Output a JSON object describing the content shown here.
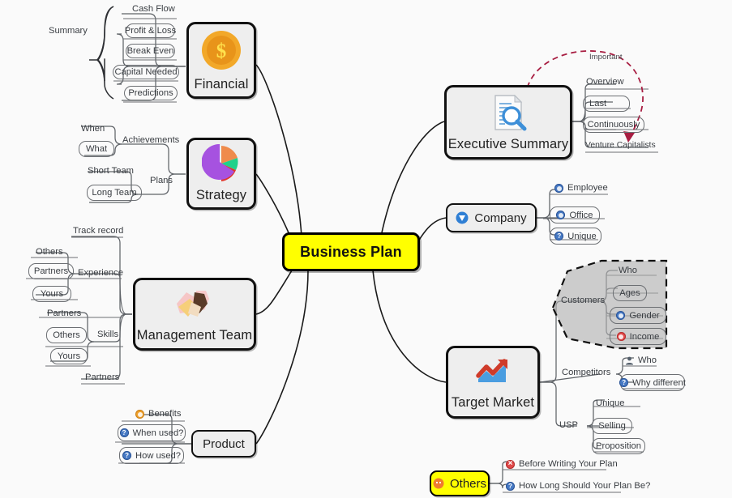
{
  "map": {
    "central": {
      "label": "Business Plan",
      "color": "#ffff00"
    },
    "annotation": {
      "label": "Important",
      "color": "#a81e42"
    },
    "branches": [
      {
        "id": "financial",
        "label": "Financial",
        "icon": "dollar-coin-icon",
        "children": [
          {
            "label": "Summary",
            "children": [
              {
                "label": "Cash Flow"
              },
              {
                "label": "Profit & Loss"
              },
              {
                "label": "Break Even"
              }
            ]
          },
          {
            "label": "Capital Needed"
          },
          {
            "label": "Predictions"
          }
        ]
      },
      {
        "id": "strategy",
        "label": "Strategy",
        "icon": "pie-chart-icon",
        "children": [
          {
            "label": "Achievements",
            "children": [
              {
                "label": "When"
              },
              {
                "label": "What"
              }
            ]
          },
          {
            "label": "Plans",
            "children": [
              {
                "label": "Short Team"
              },
              {
                "label": "Long Team"
              }
            ]
          }
        ]
      },
      {
        "id": "management-team",
        "label": "Management Team",
        "icon": "handshake-icon",
        "children": [
          {
            "label": "Track record"
          },
          {
            "label": "Experience",
            "children": [
              {
                "label": "Others"
              },
              {
                "label": "Partners"
              },
              {
                "label": "Yours"
              }
            ]
          },
          {
            "label": "Skills",
            "children": [
              {
                "label": "Partners"
              },
              {
                "label": "Others"
              },
              {
                "label": "Yours"
              }
            ]
          },
          {
            "label": "Partners"
          }
        ]
      },
      {
        "id": "product",
        "label": "Product",
        "icon": "none",
        "children": [
          {
            "label": "Benefits",
            "icon": "orange-dot-icon"
          },
          {
            "label": "When used?",
            "icon": "blue-question-icon"
          },
          {
            "label": "How used?",
            "icon": "blue-question-icon"
          }
        ]
      },
      {
        "id": "executive-summary",
        "label": "Executive Summary",
        "icon": "document-search-icon",
        "children": [
          {
            "label": "Overview"
          },
          {
            "label": "Last"
          },
          {
            "label": "Continuously"
          },
          {
            "label": "Venture Capitalists"
          }
        ]
      },
      {
        "id": "company",
        "label": "Company",
        "icon": "blue-shield-icon",
        "children": [
          {
            "label": "Employee",
            "icon": "blue-clock-icon"
          },
          {
            "label": "Office",
            "icon": "blue-dot-icon"
          },
          {
            "label": "Unique",
            "icon": "blue-question-icon"
          }
        ]
      },
      {
        "id": "target-market",
        "label": "Target Market",
        "icon": "growth-chart-icon",
        "children": [
          {
            "label": "Customers",
            "highlighted": true,
            "children": [
              {
                "label": "Who"
              },
              {
                "label": "Ages"
              },
              {
                "label": "Gender",
                "icon": "blue-person-icon"
              },
              {
                "label": "Income",
                "icon": "red-dot-icon"
              }
            ]
          },
          {
            "label": "Competitors",
            "children": [
              {
                "label": "Who",
                "icon": "person-icon"
              },
              {
                "label": "Why different",
                "icon": "blue-question-icon"
              }
            ]
          },
          {
            "label": "USP",
            "children": [
              {
                "label": "Unique"
              },
              {
                "label": "Selling"
              },
              {
                "label": "Proposition"
              }
            ]
          }
        ]
      },
      {
        "id": "others",
        "label": "Others",
        "icon": "orange-face-icon",
        "color": "#ffff00",
        "children": [
          {
            "label": "Before Writing Your Plan",
            "icon": "red-x-icon"
          },
          {
            "label": "How Long Should Your Plan Be?",
            "icon": "blue-question-icon"
          }
        ]
      }
    ]
  }
}
